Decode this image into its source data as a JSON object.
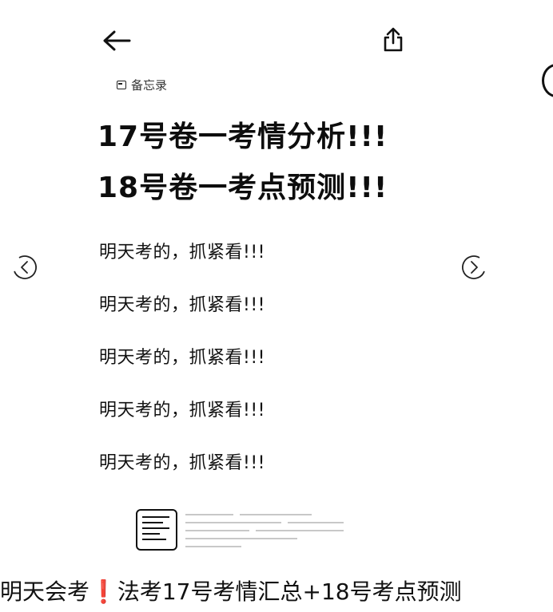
{
  "header": {
    "back_icon": "arrow-left-icon",
    "share_icon": "share-icon"
  },
  "note": {
    "source_label": "备忘录",
    "headline_1": "17号卷一考情分析!!!",
    "headline_2": "18号卷一考点预测!!!",
    "lines": [
      "明天考的，抓紧看!!!",
      "明天考的，抓紧看!!!",
      "明天考的，抓紧看!!!",
      "明天考的，抓紧看!!!",
      "明天考的，抓紧看!!!"
    ]
  },
  "carousel": {
    "prev_icon": "chevron-left-circle-icon",
    "next_icon": "chevron-right-circle-icon"
  },
  "attachment": {
    "icon": "document-icon"
  },
  "post": {
    "title": "明天会考❗法考17号考情汇总+18号考点预测"
  }
}
